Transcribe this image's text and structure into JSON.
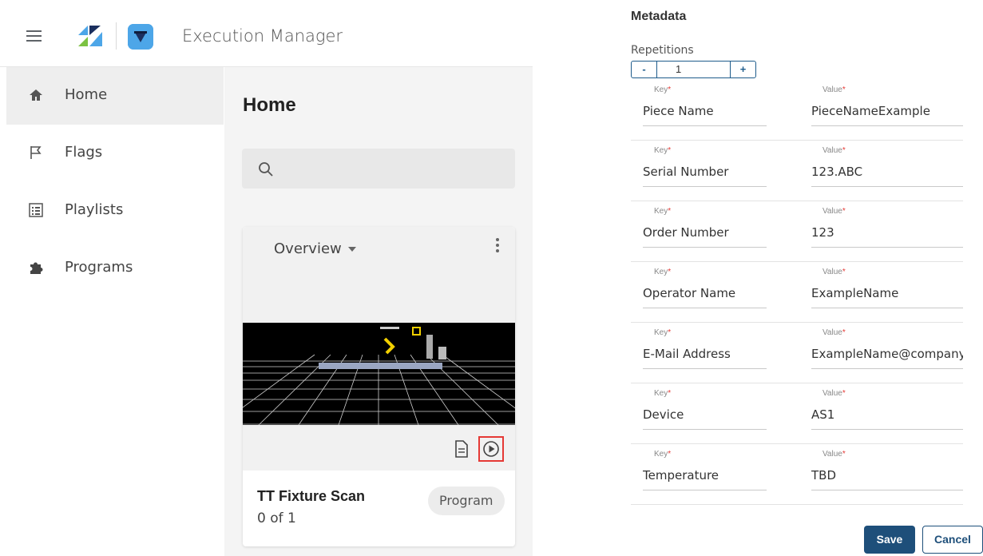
{
  "app": {
    "title": "Execution Manager",
    "brand_colors": {
      "logo_blue": "#4da6e8",
      "logo_green": "#7cc242",
      "logo_navy": "#1b2f5e"
    }
  },
  "sidebar": {
    "items": [
      {
        "label": "Home",
        "icon": "home-icon",
        "active": true
      },
      {
        "label": "Flags",
        "icon": "flag-icon",
        "active": false
      },
      {
        "label": "Playlists",
        "icon": "list-icon",
        "active": false
      },
      {
        "label": "Programs",
        "icon": "puzzle-icon",
        "active": false
      }
    ]
  },
  "main": {
    "title": "Home",
    "search_placeholder": "",
    "card": {
      "view_selector": "Overview",
      "title": "TT Fixture Scan",
      "progress": "0 of 1",
      "type_chip": "Program",
      "highlight_color": "#e53935"
    }
  },
  "metadata": {
    "title": "Metadata",
    "repetitions_label": "Repetitions",
    "repetitions": {
      "minus": "-",
      "value": "1",
      "plus": "+"
    },
    "key_label": "Key",
    "value_label": "Value",
    "required_mark": "*",
    "fields": [
      {
        "key": "Piece Name",
        "value": "PieceNameExample"
      },
      {
        "key": "Serial Number",
        "value": "123.ABC"
      },
      {
        "key": "Order Number",
        "value": "123"
      },
      {
        "key": "Operator Name",
        "value": "ExampleName"
      },
      {
        "key": "E-Mail Address",
        "value": "ExampleName@company"
      },
      {
        "key": "Device",
        "value": "AS1"
      },
      {
        "key": "Temperature",
        "value": "TBD"
      }
    ],
    "save_label": "Save",
    "cancel_label": "Cancel",
    "accent_color": "#1e4f7a"
  }
}
